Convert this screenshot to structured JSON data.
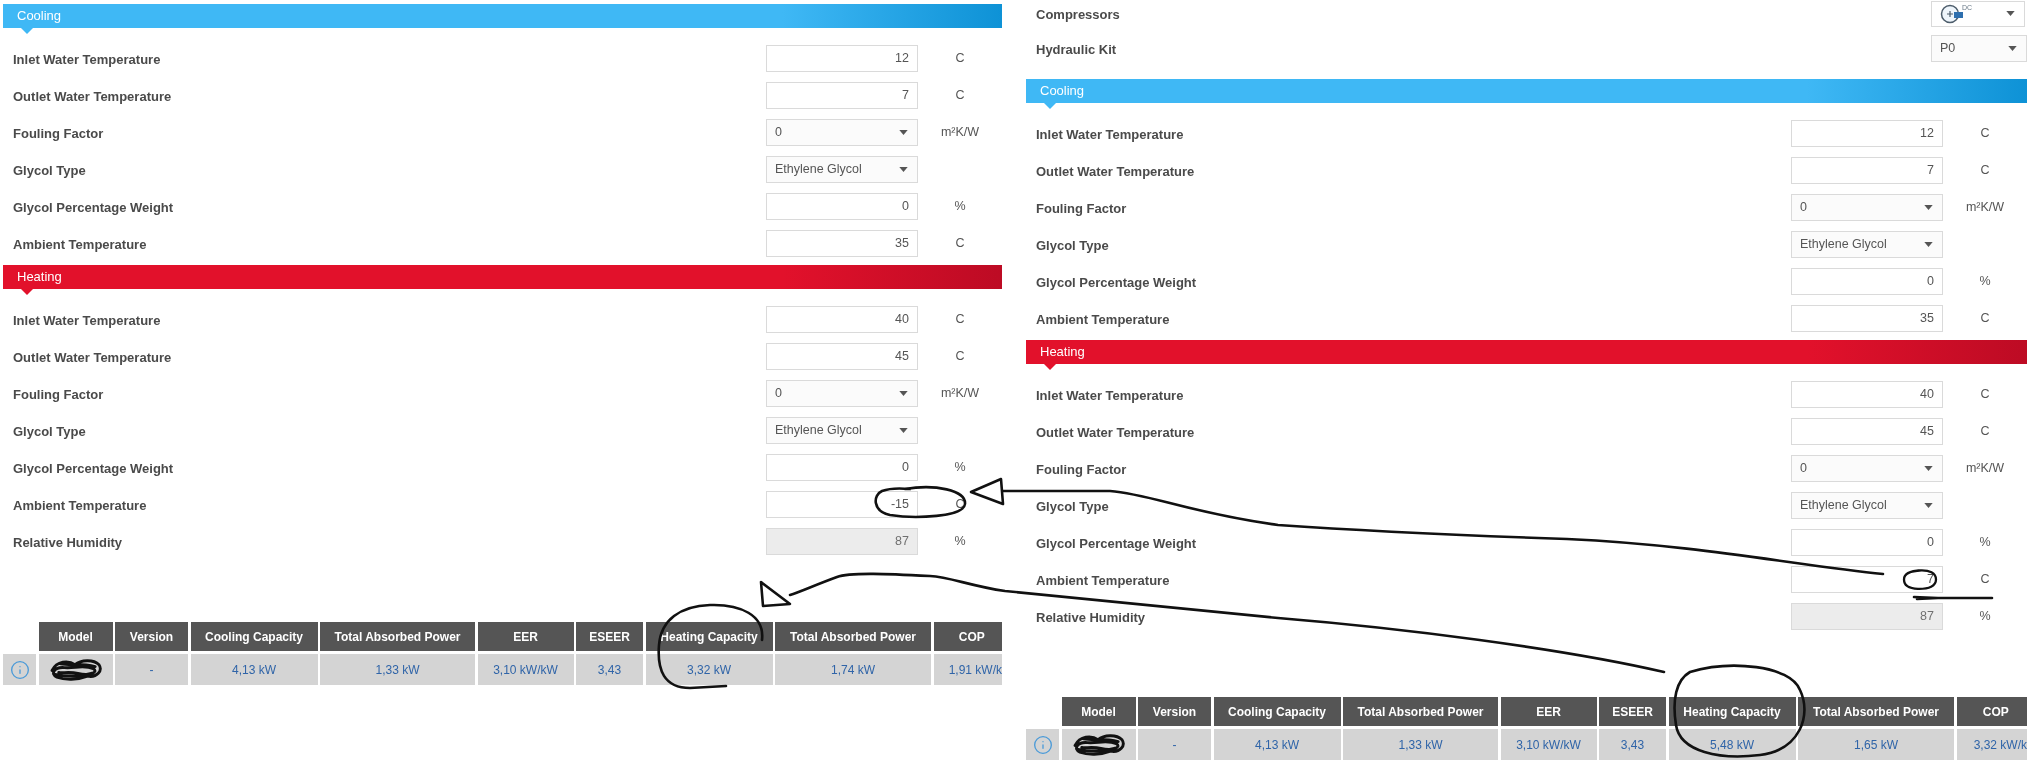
{
  "panels": [
    {
      "sections": [
        {
          "kind": "cooling",
          "title": "Cooling",
          "fields": [
            {
              "label": "Inlet Water Temperature",
              "kind": "input",
              "value": "12",
              "unit": "C"
            },
            {
              "label": "Outlet Water Temperature",
              "kind": "input",
              "value": "7",
              "unit": "C"
            },
            {
              "label": "Fouling Factor",
              "kind": "select",
              "value": "0",
              "unit": "m²K/W"
            },
            {
              "label": "Glycol Type",
              "kind": "select",
              "value": "Ethylene Glycol"
            },
            {
              "label": "Glycol Percentage Weight",
              "kind": "input",
              "value": "0",
              "unit": "%"
            },
            {
              "label": "Ambient Temperature",
              "kind": "input",
              "value": "35",
              "unit": "C"
            }
          ]
        },
        {
          "kind": "heating",
          "title": "Heating",
          "fields": [
            {
              "label": "Inlet Water Temperature",
              "kind": "input",
              "value": "40",
              "unit": "C"
            },
            {
              "label": "Outlet Water Temperature",
              "kind": "input",
              "value": "45",
              "unit": "C"
            },
            {
              "label": "Fouling Factor",
              "kind": "select",
              "value": "0",
              "unit": "m²K/W"
            },
            {
              "label": "Glycol Type",
              "kind": "select",
              "value": "Ethylene Glycol"
            },
            {
              "label": "Glycol Percentage Weight",
              "kind": "input",
              "value": "0",
              "unit": "%"
            },
            {
              "label": "Ambient Temperature",
              "kind": "input",
              "value": "-15",
              "unit": "C"
            },
            {
              "label": "Relative Humidity",
              "kind": "readonly",
              "value": "87",
              "unit": "%"
            }
          ]
        }
      ],
      "results_table": {
        "columns": [
          "Model",
          "Version",
          "Cooling Capacity",
          "Total Absorbed Power",
          "EER",
          "ESEER",
          "Heating Capacity",
          "Total Absorbed Power",
          "COP"
        ],
        "rows": [
          {
            "info": true,
            "model_scribbled": true,
            "values": [
              "-",
              "4,13 kW",
              "1,33 kW",
              "3,10 kW/kW",
              "3,43",
              "3,32 kW",
              "1,74 kW",
              "1,91 kW/k"
            ]
          }
        ]
      }
    },
    {
      "top_fields": [
        {
          "label": "Compressors",
          "kind": "icon_select",
          "value": "DC"
        },
        {
          "label": "Hydraulic Kit",
          "kind": "select",
          "value": "P0"
        }
      ],
      "sections": [
        {
          "kind": "cooling",
          "title": "Cooling",
          "fields": [
            {
              "label": "Inlet Water Temperature",
              "kind": "input",
              "value": "12",
              "unit": "C"
            },
            {
              "label": "Outlet Water Temperature",
              "kind": "input",
              "value": "7",
              "unit": "C"
            },
            {
              "label": "Fouling Factor",
              "kind": "select",
              "value": "0",
              "unit": "m²K/W"
            },
            {
              "label": "Glycol Type",
              "kind": "select",
              "value": "Ethylene Glycol"
            },
            {
              "label": "Glycol Percentage Weight",
              "kind": "input",
              "value": "0",
              "unit": "%"
            },
            {
              "label": "Ambient Temperature",
              "kind": "input",
              "value": "35",
              "unit": "C"
            }
          ]
        },
        {
          "kind": "heating",
          "title": "Heating",
          "fields": [
            {
              "label": "Inlet Water Temperature",
              "kind": "input",
              "value": "40",
              "unit": "C"
            },
            {
              "label": "Outlet Water Temperature",
              "kind": "input",
              "value": "45",
              "unit": "C"
            },
            {
              "label": "Fouling Factor",
              "kind": "select",
              "value": "0",
              "unit": "m²K/W"
            },
            {
              "label": "Glycol Type",
              "kind": "select",
              "value": "Ethylene Glycol"
            },
            {
              "label": "Glycol Percentage Weight",
              "kind": "input",
              "value": "0",
              "unit": "%"
            },
            {
              "label": "Ambient Temperature",
              "kind": "input",
              "value": "7",
              "unit": "C"
            },
            {
              "label": "Relative Humidity",
              "kind": "readonly",
              "value": "87",
              "unit": "%"
            }
          ]
        }
      ],
      "results_table": {
        "columns": [
          "Model",
          "Version",
          "Cooling Capacity",
          "Total Absorbed Power",
          "EER",
          "ESEER",
          "Heating Capacity",
          "Total Absorbed Power",
          "COP"
        ],
        "rows": [
          {
            "info": true,
            "model_scribbled": true,
            "values": [
              "-",
              "4,13 kW",
              "1,33 kW",
              "3,10 kW/kW",
              "3,43",
              "5,48 kW",
              "1,65 kW",
              "3,32 kW/k"
            ]
          }
        ]
      }
    }
  ]
}
